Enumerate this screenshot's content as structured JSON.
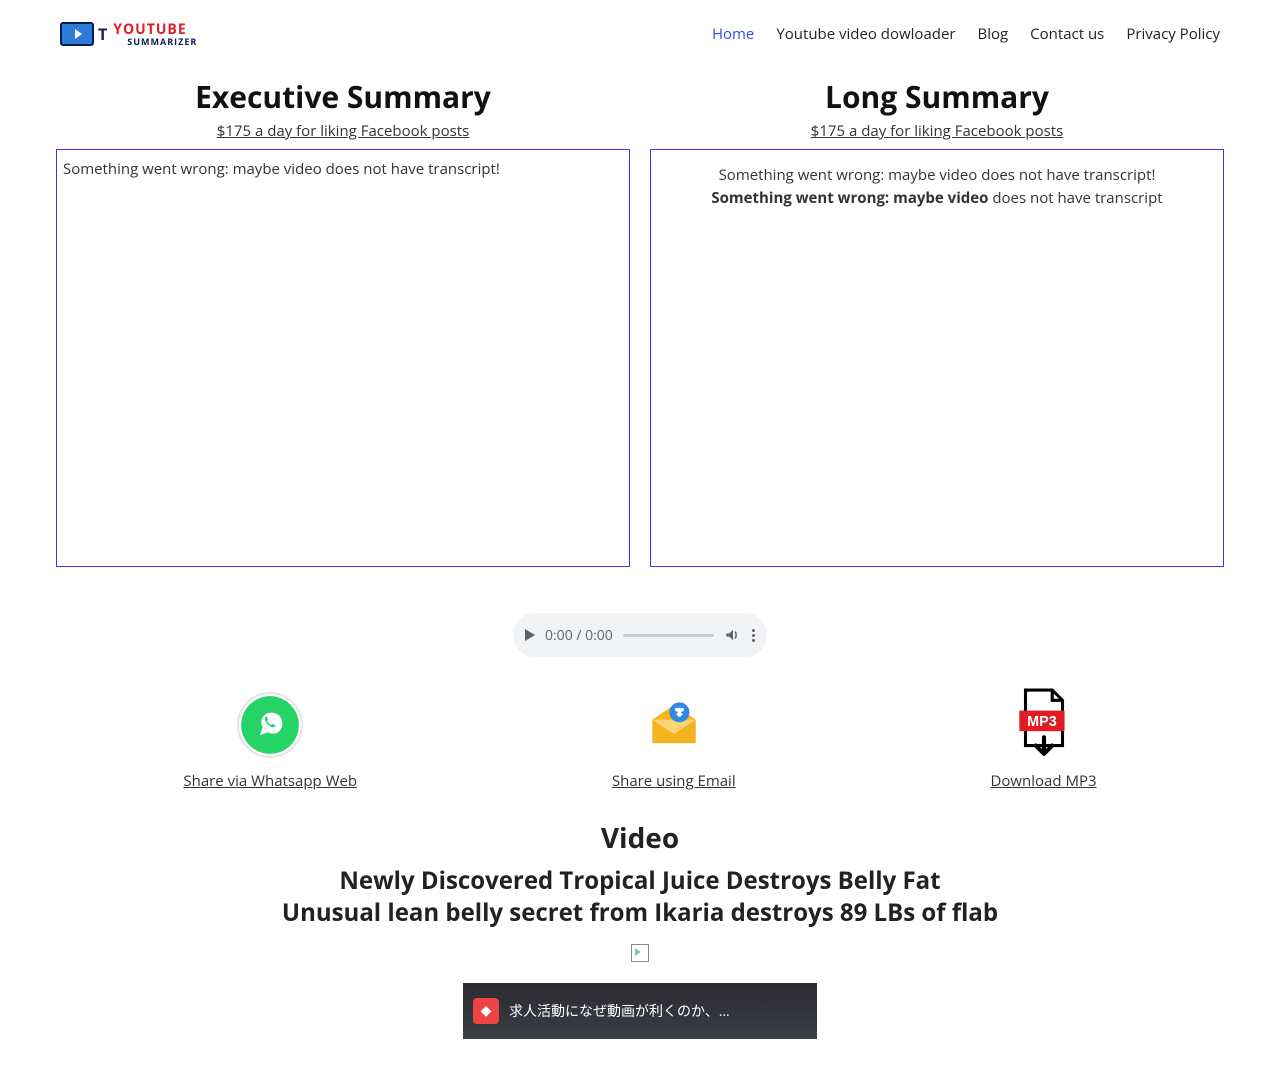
{
  "logo": {
    "line1": "YOUTUBE",
    "line2": "SUMMARIZER"
  },
  "nav": [
    {
      "label": "Home",
      "active": true
    },
    {
      "label": "Youtube video dowloader",
      "active": false
    },
    {
      "label": "Blog",
      "active": false
    },
    {
      "label": "Contact us",
      "active": false
    },
    {
      "label": "Privacy Policy",
      "active": false
    }
  ],
  "summaries": {
    "executive": {
      "title": "Executive Summary",
      "adlink": "$175 a day for liking Facebook posts",
      "content": "Something went wrong: maybe video does not have transcript!"
    },
    "long": {
      "title": "Long Summary",
      "adlink": "$175 a day for liking Facebook posts",
      "content_line1": "Something went wrong: maybe video does not have transcript!",
      "content_line2_bold": "Something went wrong: maybe video",
      "content_line2_rest": " does not have transcript"
    }
  },
  "audio": {
    "time": "0:00 / 0:00"
  },
  "share": {
    "whatsapp": "Share via Whatsapp Web",
    "email": "Share using Email",
    "mp3": "Download MP3",
    "mp3_badge": "MP3"
  },
  "video_section": {
    "heading": "Video",
    "line1": "Newly Discovered Tropical Juice Destroys Belly Fat",
    "line2": "Unusual lean belly secret from Ikaria destroys 89 LBs of flab",
    "embed_title": "求人活動になぜ動画が利くのか、…"
  }
}
